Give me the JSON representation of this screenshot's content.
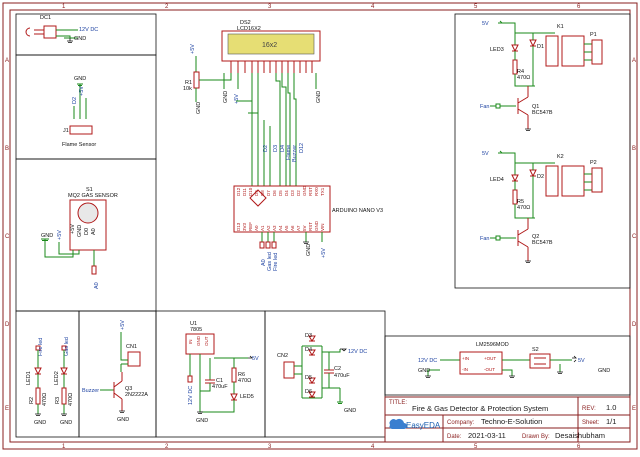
{
  "diagram": {
    "grid_numbers": [
      "1",
      "2",
      "3",
      "4",
      "5",
      "6"
    ],
    "grid_letters": [
      "A",
      "B",
      "C",
      "D",
      "E"
    ],
    "parts": {
      "dc1": {
        "ref": "DC1",
        "net": "12V DC",
        "gnd": "GND"
      },
      "flame": {
        "ref": "J1",
        "name": "Flame Sensor",
        "gnd": "GND",
        "vcc": "+5V",
        "pin": "D2"
      },
      "gas": {
        "ref": "S1",
        "name": "MQ2 GAS SENSOR",
        "gnd": "GND",
        "vcc": "+5V",
        "pins": [
          "+5V",
          "GND",
          "D0",
          "A0"
        ],
        "net": "A0"
      },
      "lcd": {
        "ref": "DS2",
        "name": "LCD16X2",
        "text": "16x2",
        "pot": "R1",
        "pot_val": "10k",
        "vcc": "+5V",
        "gnd": "GND"
      },
      "nano": {
        "ref": "ARDUINO NANO V3",
        "nets": [
          "D2",
          "D3",
          "D4",
          "Flame",
          "Buzzer",
          "D12",
          "A0",
          "Gas led",
          "Fire led",
          "GND",
          "+5V"
        ],
        "top_pins": [
          "D12",
          "D11",
          "D10",
          "D9",
          "D8",
          "D7",
          "D6",
          "D5",
          "D4",
          "D3",
          "D2",
          "GND",
          "RST",
          "RX0",
          "TX1"
        ],
        "bottom_pins": [
          "D13",
          "3V3",
          "REF",
          "A0",
          "A1",
          "A2",
          "A3",
          "A4",
          "A5",
          "A6",
          "A7",
          "5V",
          "RST",
          "GND",
          "VIN"
        ]
      },
      "relay1": {
        "ref": "K1",
        "conn": "P1",
        "led": "LED3",
        "res": "R4",
        "res_val": "470Ω",
        "diode": "D1",
        "trans": "Q1",
        "trans_val": "BC547B",
        "net": "Fan",
        "vcc": "5V"
      },
      "relay2": {
        "ref": "K2",
        "conn": "P2",
        "led": "LED4",
        "res": "R5",
        "res_val": "470Ω",
        "diode": "D2",
        "trans": "Q2",
        "trans_val": "BC547B",
        "net": "Fan",
        "vcc": "5V"
      },
      "leds": {
        "led1": "LED1",
        "led2": "LED2",
        "r2": "R2",
        "r2_val": "470Ω",
        "r3": "R3",
        "r3_val": "470Ω",
        "net1": "Fire led",
        "net2": "Gas led",
        "gnd": "GND"
      },
      "buzzer": {
        "ref": "CN1",
        "q": "Q3",
        "q_val": "2N2222A",
        "net": "Buzzer",
        "vcc": "+5V",
        "gnd": "GND"
      },
      "regulator": {
        "ref": "U1",
        "val": "7805",
        "pins": [
          "IN",
          "OUT",
          "GND"
        ],
        "c1": "C1",
        "c1_val": "470uF",
        "r6": "R6",
        "r6_val": "470Ω",
        "led5": "LED5",
        "net_in": "12V DC",
        "net_out": "5V",
        "gnd": "GND"
      },
      "bridge": {
        "ref": "CN2",
        "d": [
          "D3",
          "D4",
          "D5",
          "D6"
        ],
        "c2": "C2",
        "c2_val": "470uF",
        "net": "12V DC",
        "gnd": "GND"
      },
      "buck": {
        "ref": "U3",
        "val": "LM2596MOD",
        "pins": [
          "+IN",
          "-IN",
          "+OUT",
          "-OUT"
        ],
        "sw": "S2",
        "net_in": "12V DC",
        "net_out": "5V",
        "gnd": "GND"
      }
    },
    "title_block": {
      "title_label": "TITLE:",
      "title": "Fire & Gas Detector & Protection System",
      "rev_label": "REV:",
      "rev": "1.0",
      "company_label": "Company:",
      "company": "Techno-E-Solution",
      "sheet_label": "Sheet:",
      "sheet": "1/1",
      "date_label": "Date:",
      "date": "2021-03-11",
      "drawn_label": "Drawn By:",
      "drawn": "Desaishubham",
      "logo": "EasyEDA"
    }
  }
}
